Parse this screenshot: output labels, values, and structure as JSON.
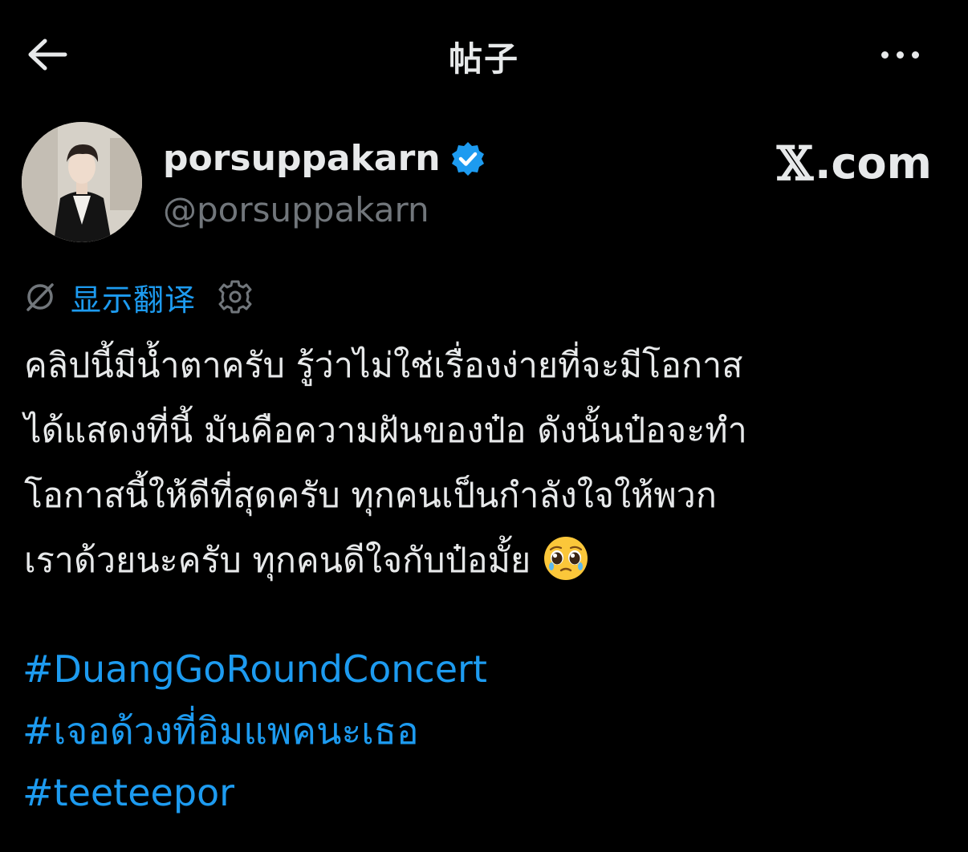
{
  "header": {
    "title": "帖子",
    "back_icon": "arrow-left-icon",
    "more_icon": "more-horizontal-icon"
  },
  "author": {
    "display_name": "porsuppakarn",
    "handle": "@porsuppakarn",
    "verified": true,
    "verified_color": "#1d9bf0"
  },
  "brand": {
    "logo_letter": "𝕏",
    "suffix": ".com"
  },
  "translate": {
    "label": "显示翻译",
    "icon": "translate-off-icon",
    "settings_icon": "gear-icon"
  },
  "post": {
    "lines": [
      "คลิปนี้มีน้ำตาครับ รู้ว่าไม่ใช่เรื่องง่ายที่จะมีโอกาส",
      "ได้แสดงที่นี้ มันคือความฝันของป๋อ ดังนั้นป๋อจะทำ",
      "โอกาสนี้ให้ดีที่สุดครับ ทุกคนเป็นกำลังใจให้พวก",
      "เราด้วยนะครับ ทุกคนดีใจกับป๋อมั้ย"
    ],
    "emoji": "pleading-face-emoji",
    "hashtags": [
      "#DuangGoRoundConcert",
      "#เจอด้วงที่อิมแพคนะเธอ",
      "#teeteepor"
    ]
  },
  "colors": {
    "background": "#000000",
    "text": "#e7e9ea",
    "muted": "#71767b",
    "accent": "#1d9bf0"
  }
}
